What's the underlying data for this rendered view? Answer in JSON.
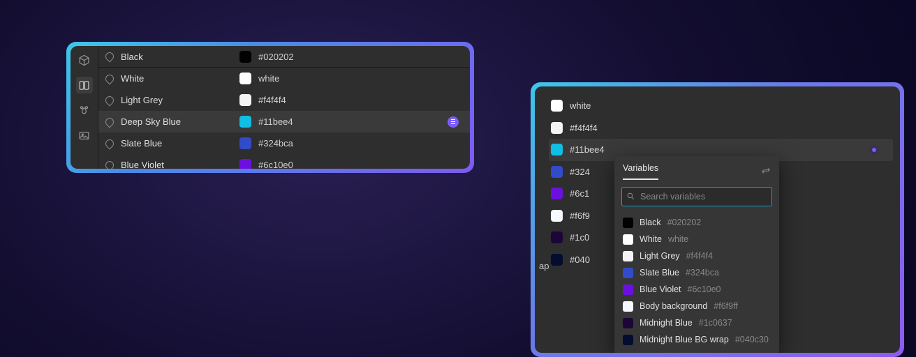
{
  "panel1": {
    "rows": [
      {
        "name": "Black",
        "value": "#020202",
        "swatch": "#020202"
      },
      {
        "name": "White",
        "value": "white",
        "swatch": "#ffffff"
      },
      {
        "name": "Light Grey",
        "value": "#f4f4f4",
        "swatch": "#f4f4f4"
      },
      {
        "name": "Deep Sky Blue",
        "value": "#11bee4",
        "swatch": "#11bee4",
        "selected": true,
        "badge": true
      },
      {
        "name": "Slate Blue",
        "value": "#324bca",
        "swatch": "#324bca"
      },
      {
        "name": "Blue Violet",
        "value": "#6c10e0",
        "swatch": "#6c10e0"
      }
    ]
  },
  "panel2": {
    "rows": [
      {
        "value": "white",
        "swatch": "#ffffff"
      },
      {
        "value": "#f4f4f4",
        "swatch": "#f4f4f4"
      },
      {
        "value": "#11bee4",
        "swatch": "#11bee4",
        "selected": true,
        "dot": true
      },
      {
        "value": "#324",
        "swatch": "#324bca"
      },
      {
        "value": "#6c1",
        "swatch": "#6c10e0"
      },
      {
        "value": "#f6f9",
        "swatch": "#f6f9ff"
      },
      {
        "value": "#1c0",
        "swatch": "#1c0637"
      },
      {
        "value": "#040",
        "swatch": "#040c30"
      }
    ],
    "truncated": "ap"
  },
  "popup": {
    "tab": "Variables",
    "placeholder": "Search variables",
    "items": [
      {
        "name": "Black",
        "value": "#020202",
        "swatch": "#020202"
      },
      {
        "name": "White",
        "value": "white",
        "swatch": "#ffffff"
      },
      {
        "name": "Light Grey",
        "value": "#f4f4f4",
        "swatch": "#f4f4f4"
      },
      {
        "name": "Slate Blue",
        "value": "#324bca",
        "swatch": "#324bca"
      },
      {
        "name": "Blue Violet",
        "value": "#6c10e0",
        "swatch": "#6c10e0"
      },
      {
        "name": "Body background",
        "value": "#f6f9ff",
        "swatch": "#f6f9ff"
      },
      {
        "name": "Midnight Blue",
        "value": "#1c0637",
        "swatch": "#1c0637"
      },
      {
        "name": "Midnight Blue BG wrap",
        "value": "#040c30",
        "swatch": "#040c30"
      }
    ]
  }
}
